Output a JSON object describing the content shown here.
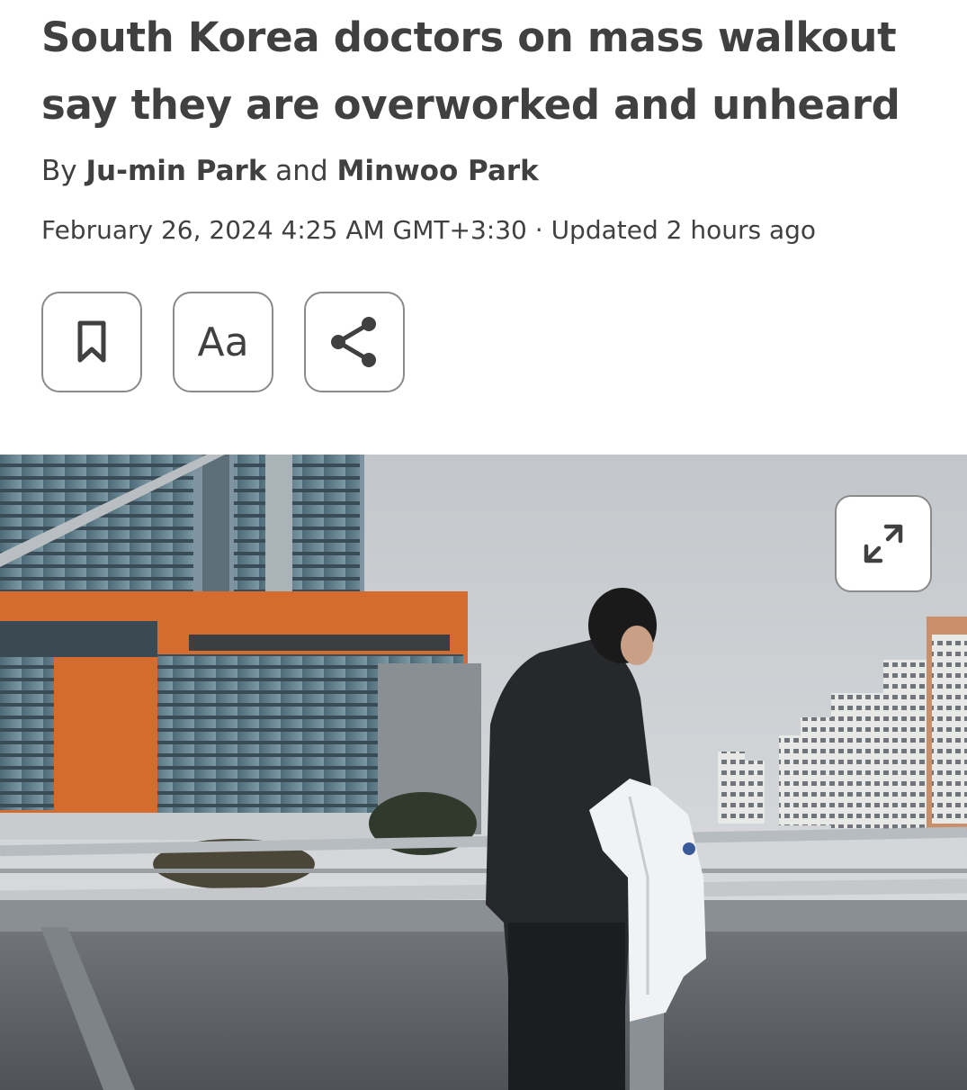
{
  "article": {
    "headline": "South Korea doctors on mass walkout say they are overworked and unheard",
    "byline": {
      "prefix": "By ",
      "author1": "Ju-min Park",
      "conjunction": " and ",
      "author2": "Minwoo Park"
    },
    "dateline": {
      "published": "February 26, 2024 4:25 AM GMT+3:30",
      "separator": " · ",
      "updated": "Updated 2 hours ago"
    }
  },
  "toolbar": {
    "bookmark_icon": "bookmark-icon",
    "text_size_label": "Aa",
    "share_icon": "share-icon"
  },
  "hero": {
    "image_description": "doctor-holding-white-coat-on-bridge",
    "expand_icon": "expand-icon"
  },
  "colors": {
    "text": "#404040",
    "button_border": "#8a8a8a",
    "background": "#ffffff"
  }
}
